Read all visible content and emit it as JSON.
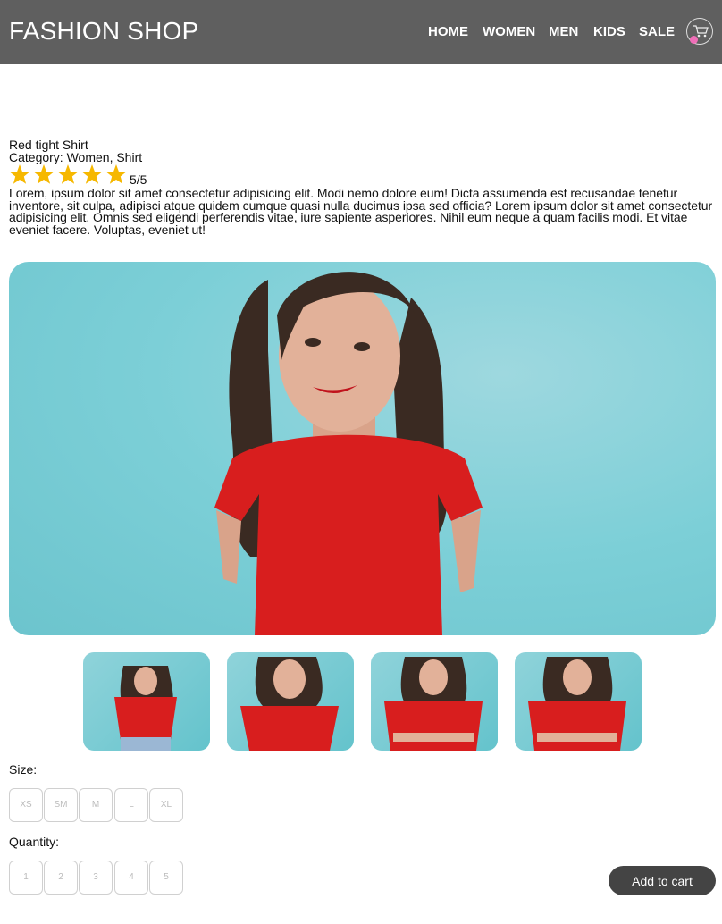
{
  "header": {
    "logo": "FASHION SHOP",
    "nav": [
      "HOME",
      "WOMEN",
      "MEN",
      "KIDS",
      "SALE"
    ],
    "cart_icon": "cart-icon"
  },
  "product": {
    "name": "Red tight Shirt",
    "category": "Category: Women, Shirt",
    "rating": 5,
    "rating_max": 5,
    "rating_text": "5/5",
    "description": "Lorem, ipsum dolor sit amet consectetur adipisicing elit. Modi nemo dolore eum! Dicta assumenda est recusandae tenetur inventore, sit culpa, adipisci atque quidem cumque quasi nulla ducimus ipsa sed officia? Lorem ipsum dolor sit amet consectetur adipisicing elit. Omnis sed eligendi perferendis vitae, iure sapiente asperiores. Nihil eum neque a quam facilis modi. Et vitae eveniet facere. Voluptas, eveniet ut!"
  },
  "size": {
    "label": "Size:",
    "options": [
      "XS",
      "SM",
      "M",
      "L",
      "XL"
    ]
  },
  "quantity": {
    "label": "Quantity:",
    "options": [
      "1",
      "2",
      "3",
      "4",
      "5"
    ]
  },
  "add_to_cart_label": "Add to cart",
  "colors": {
    "header_bg": "#5f5f5f",
    "star": "#f6b800",
    "image_bg": "#7ccfd7",
    "shirt": "#d81e1e",
    "button_bg": "#444444",
    "cart_dot": "#f06fb8"
  }
}
